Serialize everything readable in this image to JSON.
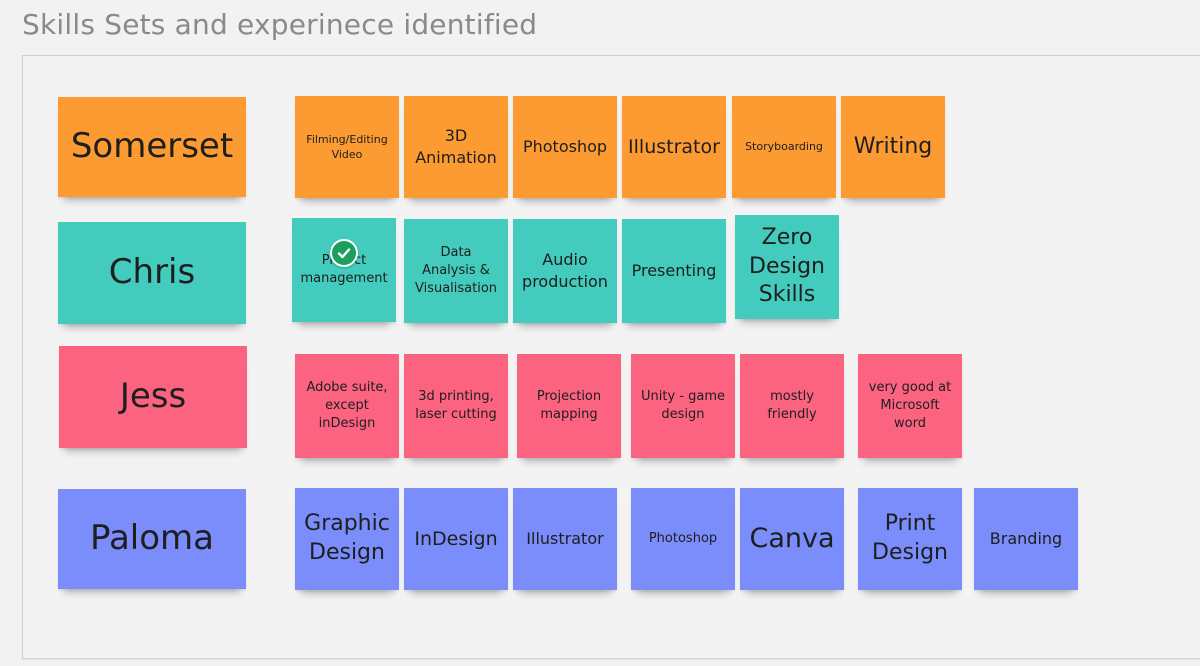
{
  "board": {
    "title": "Skills Sets and experinece identified"
  },
  "colors": {
    "orange": "#fb9b32",
    "teal": "#43cbbe",
    "pink": "#fb6381",
    "blue": "#7a8dfa",
    "check": "#1aa05a"
  },
  "rows": [
    {
      "name": "Somerset",
      "color": "orange",
      "skills": [
        "Filming/Editing\nVideo",
        "3D\nAnimation",
        "Photoshop",
        "Illustrator",
        "Storyboarding",
        "Writing"
      ]
    },
    {
      "name": "Chris",
      "color": "teal",
      "skills": [
        "Project\nmanagement",
        "Data\nAnalysis &\nVisualisation",
        "Audio\nproduction",
        "Presenting",
        "Zero\nDesign\nSkills"
      ]
    },
    {
      "name": "Jess",
      "color": "pink",
      "skills": [
        "Adobe suite,\nexcept\ninDesign",
        "3d printing,\nlaser cutting",
        "Projection\nmapping",
        "Unity - game\ndesign",
        "mostly\nfriendly",
        "very good at\nMicrosoft\nword"
      ]
    },
    {
      "name": "Paloma",
      "color": "blue",
      "skills": [
        "Graphic\nDesign",
        "InDesign",
        "Illustrator",
        "Photoshop",
        "Canva",
        "Print\nDesign",
        "Branding"
      ]
    }
  ],
  "icons": {
    "checked_note": "check-circle-icon"
  }
}
